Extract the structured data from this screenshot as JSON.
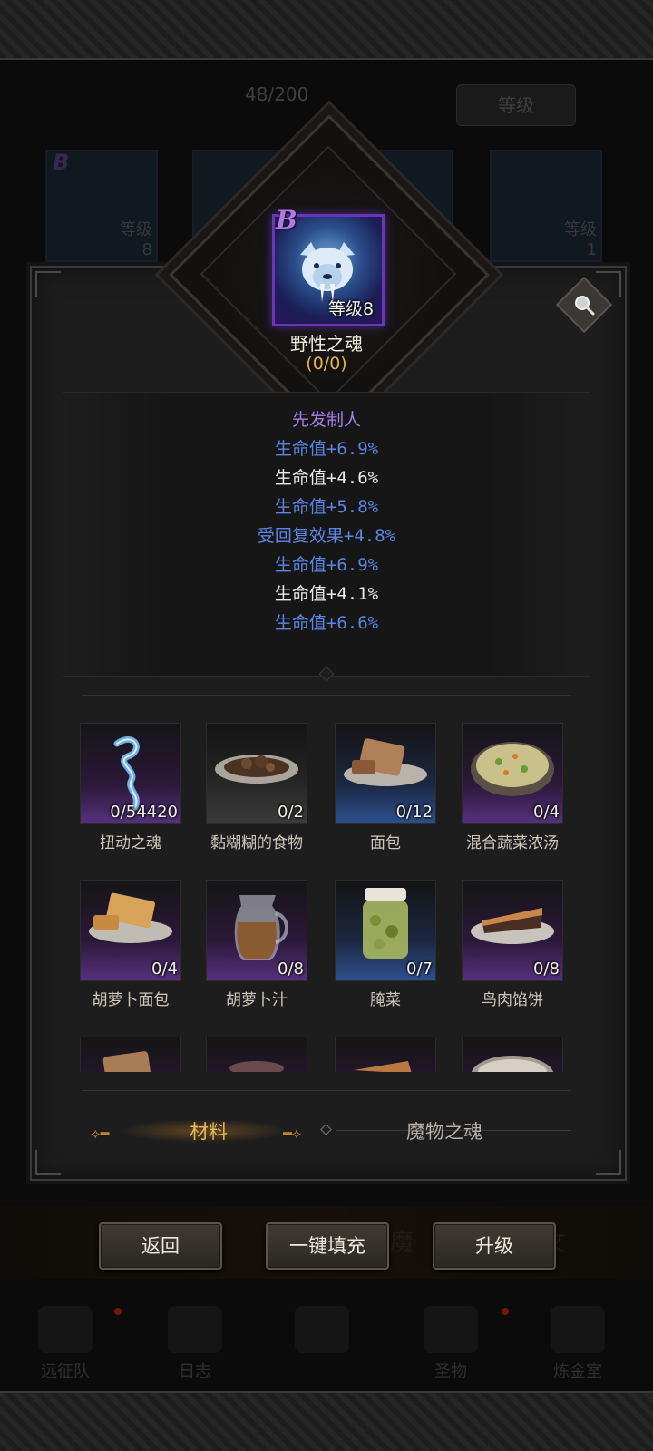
{
  "background": {
    "counter": "48/200",
    "level_button": "等级",
    "cards": [
      {
        "level_label": "等级",
        "level": "8"
      },
      {
        "level_label": "",
        "level": ""
      },
      {
        "level_label": "等级",
        "level": "1"
      },
      {
        "level_label": "等级",
        "level": "1"
      }
    ],
    "rarity": "B",
    "bottom_row_text": [
      "魔",
      "文"
    ],
    "nav_tabs": [
      "远征队",
      "日志",
      "",
      "圣物",
      "炼金室"
    ]
  },
  "soul": {
    "rarity": "B",
    "level_text": "等级8",
    "name": "野性之魂",
    "count": "(0/0)"
  },
  "attributes": [
    {
      "text": "先发制人",
      "color": "purple"
    },
    {
      "text": "生命值+6.9%",
      "color": "blue"
    },
    {
      "text": "生命值+4.6%",
      "color": "white"
    },
    {
      "text": "生命值+5.8%",
      "color": "blue"
    },
    {
      "text": "受回复效果+4.8%",
      "color": "blue"
    },
    {
      "text": "生命值+6.9%",
      "color": "blue"
    },
    {
      "text": "生命值+4.1%",
      "color": "white"
    },
    {
      "text": "生命值+6.6%",
      "color": "blue"
    }
  ],
  "materials": [
    {
      "name": "扭动之魂",
      "count": "0/54420",
      "rarity": "purple",
      "icon": "wisp-icon"
    },
    {
      "name": "黏糊糊的食物",
      "count": "0/2",
      "rarity": "gray",
      "icon": "stew-plate-icon"
    },
    {
      "name": "面包",
      "count": "0/12",
      "rarity": "blue",
      "icon": "bread-icon"
    },
    {
      "name": "混合蔬菜浓汤",
      "count": "0/4",
      "rarity": "purple",
      "icon": "soup-bowl-icon"
    },
    {
      "name": "胡萝卜面包",
      "count": "0/4",
      "rarity": "purple",
      "icon": "carrot-bread-icon"
    },
    {
      "name": "胡萝卜汁",
      "count": "0/8",
      "rarity": "purple",
      "icon": "juice-jug-icon"
    },
    {
      "name": "腌菜",
      "count": "0/7",
      "rarity": "blue",
      "icon": "pickle-jar-icon"
    },
    {
      "name": "鸟肉馅饼",
      "count": "0/8",
      "rarity": "purple",
      "icon": "pie-slice-icon"
    },
    {
      "name": "",
      "count": "",
      "rarity": "purple",
      "icon": "bread-icon"
    },
    {
      "name": "",
      "count": "",
      "rarity": "purple",
      "icon": "meat-icon"
    },
    {
      "name": "",
      "count": "",
      "rarity": "purple",
      "icon": "pie-slice-icon"
    },
    {
      "name": "",
      "count": "",
      "rarity": "purple",
      "icon": "soup-bowl-icon"
    }
  ],
  "tabs": {
    "materials": "材料",
    "monster_soul": "魔物之魂"
  },
  "actions": {
    "back": "返回",
    "auto_fill": "一键填充",
    "upgrade": "升级"
  },
  "colors": {
    "attr_purple": "#a77fe8",
    "attr_blue": "#5c86e6",
    "attr_white": "#ecebe6",
    "tab_active": "#e5b85a",
    "rarity_b": "#b07be0"
  }
}
